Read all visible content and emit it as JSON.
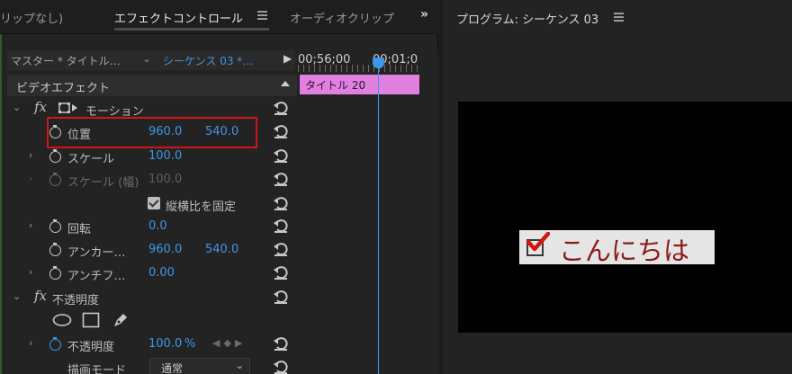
{
  "tabs": [
    {
      "label": "リップなし)",
      "active": false
    },
    {
      "label": "エフェクトコントロール",
      "active": true
    },
    {
      "label": "オーディオクリップ",
      "active": false
    }
  ],
  "overflow_label": "»",
  "effect_controls": {
    "master_label": "マスター * タイトル…",
    "sequence_label": "シーケンス 03 *…",
    "section_label": "ビデオエフェクト",
    "motion_label": "モーション",
    "position": {
      "label": "位置",
      "x": "960.0",
      "y": "540.0"
    },
    "scale": {
      "label": "スケール",
      "value": "100.0"
    },
    "scale_width": {
      "label": "スケール (幅)",
      "value": "100.0"
    },
    "uniform_scale_label": "縦横比を固定",
    "rotation": {
      "label": "回転",
      "value": "0.0"
    },
    "anchor": {
      "label": "アンカー…",
      "x": "960.0",
      "y": "540.0"
    },
    "antiflicker": {
      "label": "アンチフ…",
      "value": "0.00"
    },
    "opacity_section_label": "不透明度",
    "opacity": {
      "label": "不透明度",
      "value": "100.0",
      "unit": "%"
    },
    "blend_mode": {
      "label": "描画モード",
      "value": "通常"
    }
  },
  "timeline": {
    "time_left": "00;56;00",
    "time_right": "00;01;0",
    "clip_label": "タイトル 20"
  },
  "program": {
    "title": "プログラム: シーケンス 03",
    "title_card_text": "こんにちは"
  },
  "colors": {
    "accent": "#3e96e6",
    "clip": "#e080e0",
    "highlight": "#d51414",
    "title_text": "#8b1a1a"
  }
}
